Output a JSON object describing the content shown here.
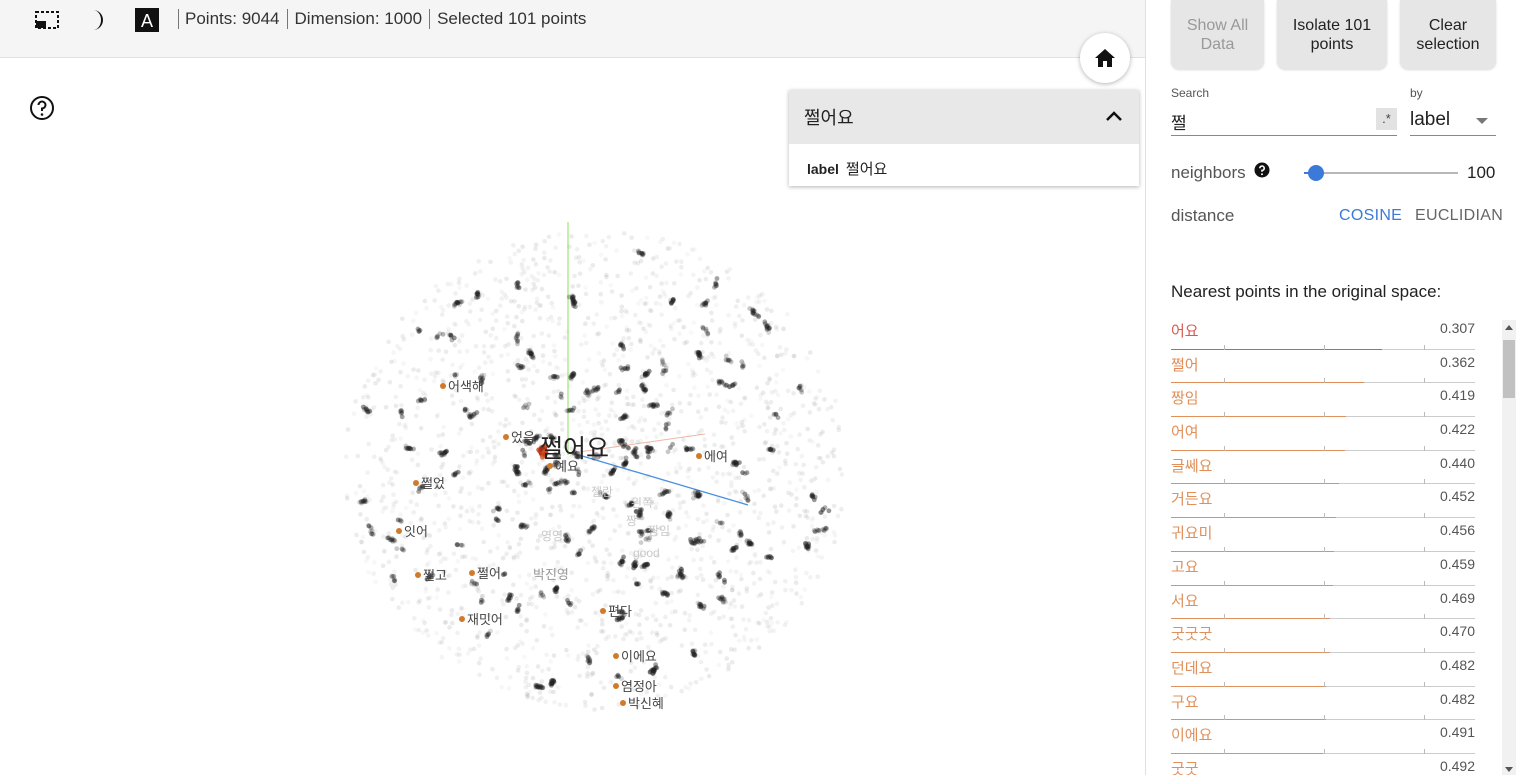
{
  "toolbar": {
    "stats": {
      "points": "Points: 9044",
      "dimension": "Dimension: 1000",
      "selected": "Selected 101 points"
    }
  },
  "inspector": {
    "title": "쩔어요",
    "field_key": "label",
    "field_value": "쩔어요"
  },
  "plot": {
    "selected_label": "쩔어요",
    "neighbor_labels": [
      "어색해",
      "었음",
      "예요",
      "에여",
      "쩔었",
      "잇어",
      "쩔고",
      "쩔어",
      "재밋어",
      "편다",
      "이에요",
      "염정아",
      "박신혜",
      "박진영"
    ],
    "faded_labels": [
      "영영",
      "good",
      "짱임",
      "왼쪽",
      "짱",
      "젤란"
    ]
  },
  "panel": {
    "buttons": {
      "show_all": "Show All Data",
      "isolate": "Isolate 101 points",
      "clear": "Clear selection"
    },
    "search": {
      "label": "Search",
      "value": "쩔",
      "regex": ".*",
      "by_label": "by",
      "by_value": "label"
    },
    "neighbors": {
      "label": "neighbors",
      "value": "100",
      "fraction": 0.06
    },
    "distance": {
      "label": "distance",
      "options": [
        "COSINE",
        "EUCLIDIAN"
      ],
      "selected": "COSINE"
    },
    "nearest_title": "Nearest points in the original space:",
    "nearest": [
      {
        "label": "어요",
        "value": "0.307"
      },
      {
        "label": "쩔어",
        "value": "0.362"
      },
      {
        "label": "짱임",
        "value": "0.419"
      },
      {
        "label": "어여",
        "value": "0.422"
      },
      {
        "label": "글쎄요",
        "value": "0.440"
      },
      {
        "label": "거든요",
        "value": "0.452"
      },
      {
        "label": "귀요미",
        "value": "0.456"
      },
      {
        "label": "고요",
        "value": "0.459"
      },
      {
        "label": "서요",
        "value": "0.469"
      },
      {
        "label": "굿굿굿",
        "value": "0.470"
      },
      {
        "label": "던데요",
        "value": "0.482"
      },
      {
        "label": "구요",
        "value": "0.482"
      },
      {
        "label": "이에요",
        "value": "0.491"
      },
      {
        "label": "굿굿",
        "value": "0.492"
      }
    ]
  },
  "colors": {
    "accent": "#3b7ad8",
    "nn_strong": "#d9534f",
    "nn_weak": "#e0905a"
  }
}
